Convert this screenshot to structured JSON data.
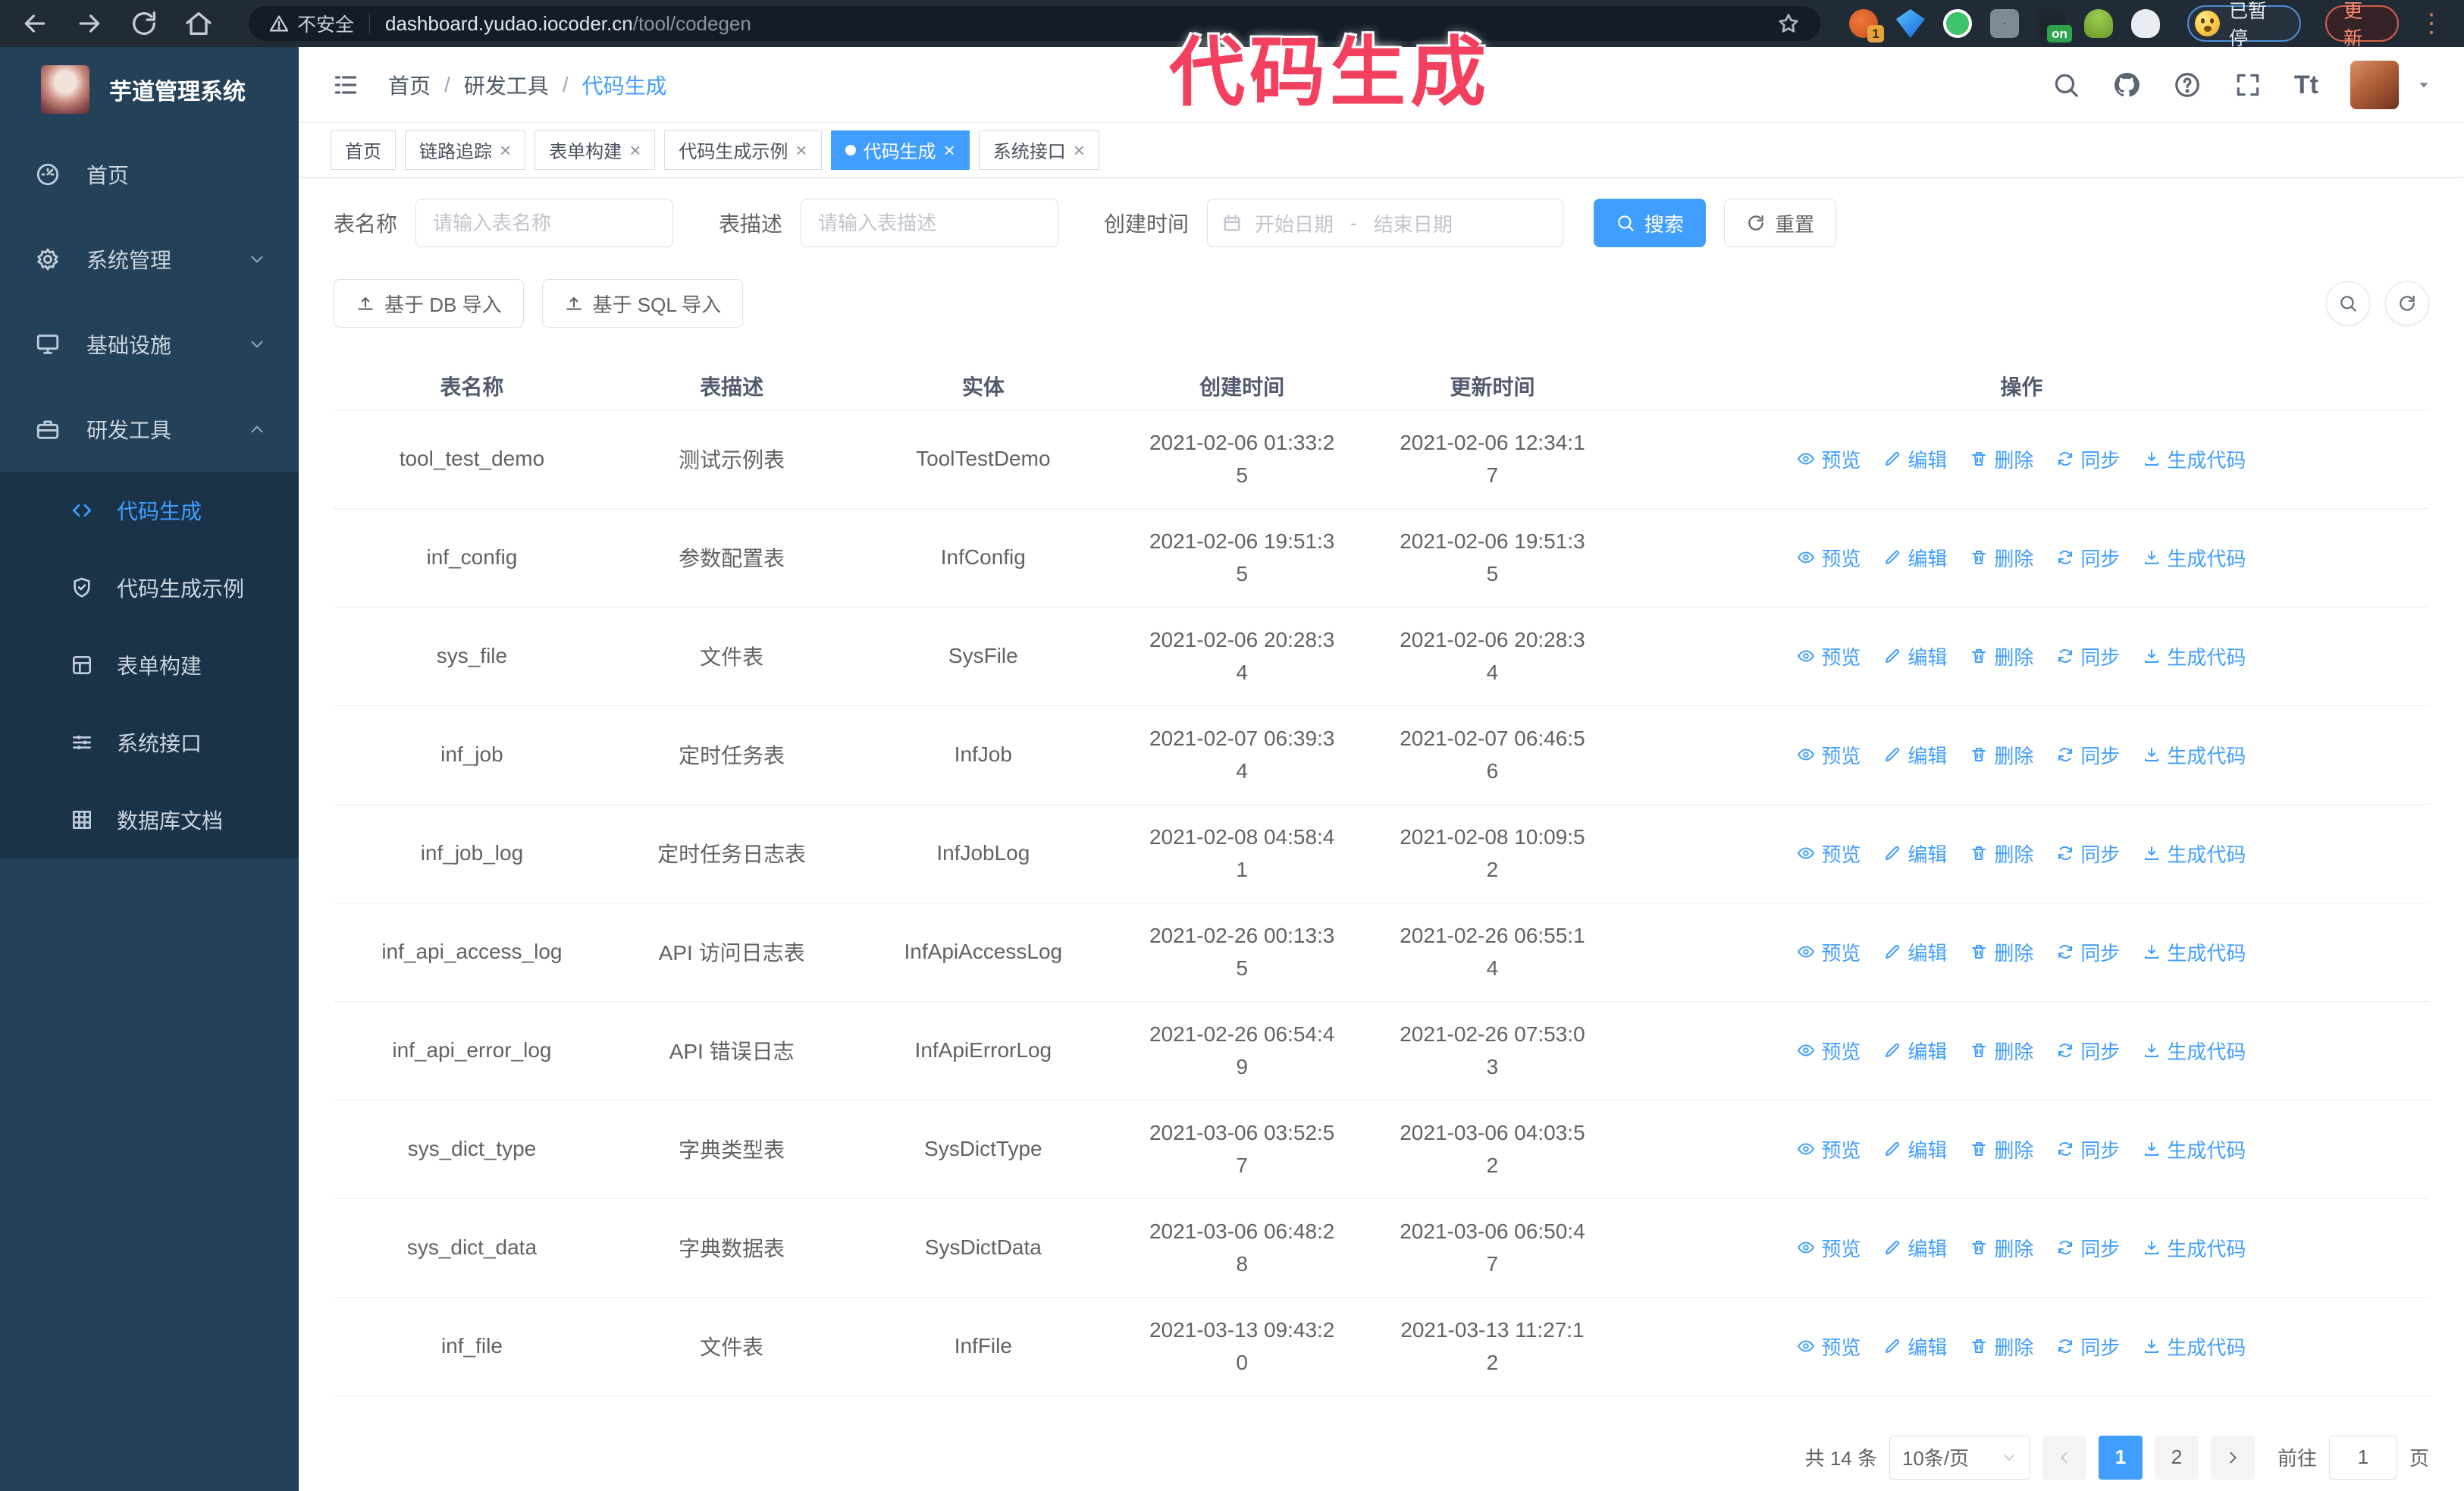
{
  "browser": {
    "security_label": "不安全",
    "url_host": "dashboard.yudao.iocoder.cn",
    "url_path": "/tool/codegen",
    "ext_badge_count": "1",
    "ext_badge_on": "on",
    "paused_label": "已暂停",
    "update_label": "更新"
  },
  "annotation": {
    "text": "代码生成"
  },
  "sidebar": {
    "title": "芋道管理系统",
    "items": [
      {
        "label": "首页"
      },
      {
        "label": "系统管理"
      },
      {
        "label": "基础设施"
      },
      {
        "label": "研发工具"
      }
    ],
    "sub_items": [
      {
        "label": "代码生成"
      },
      {
        "label": "代码生成示例"
      },
      {
        "label": "表单构建"
      },
      {
        "label": "系统接口"
      },
      {
        "label": "数据库文档"
      }
    ]
  },
  "breadcrumb": {
    "items": [
      "首页",
      "研发工具",
      "代码生成"
    ],
    "separator": "/"
  },
  "tabs": [
    {
      "label": "首页"
    },
    {
      "label": "链路追踪"
    },
    {
      "label": "表单构建"
    },
    {
      "label": "代码生成示例"
    },
    {
      "label": "代码生成"
    },
    {
      "label": "系统接口"
    }
  ],
  "filters": {
    "name_label": "表名称",
    "name_placeholder": "请输入表名称",
    "desc_label": "表描述",
    "desc_placeholder": "请输入表描述",
    "time_label": "创建时间",
    "start_placeholder": "开始日期",
    "range_separator": "-",
    "end_placeholder": "结束日期",
    "search_label": "搜索",
    "reset_label": "重置"
  },
  "toolbar": {
    "db_import_label": "基于 DB 导入",
    "sql_import_label": "基于 SQL 导入"
  },
  "table": {
    "columns": [
      "表名称",
      "表描述",
      "实体",
      "创建时间",
      "更新时间",
      "操作"
    ],
    "action_labels": [
      "预览",
      "编辑",
      "删除",
      "同步",
      "生成代码"
    ],
    "rows": [
      {
        "name": "tool_test_demo",
        "desc": "测试示例表",
        "entity": "ToolTestDemo",
        "created": "2021-02-06 01:33:25",
        "updated": "2021-02-06 12:34:17"
      },
      {
        "name": "inf_config",
        "desc": "参数配置表",
        "entity": "InfConfig",
        "created": "2021-02-06 19:51:35",
        "updated": "2021-02-06 19:51:35"
      },
      {
        "name": "sys_file",
        "desc": "文件表",
        "entity": "SysFile",
        "created": "2021-02-06 20:28:34",
        "updated": "2021-02-06 20:28:34"
      },
      {
        "name": "inf_job",
        "desc": "定时任务表",
        "entity": "InfJob",
        "created": "2021-02-07 06:39:34",
        "updated": "2021-02-07 06:46:56"
      },
      {
        "name": "inf_job_log",
        "desc": "定时任务日志表",
        "entity": "InfJobLog",
        "created": "2021-02-08 04:58:41",
        "updated": "2021-02-08 10:09:52"
      },
      {
        "name": "inf_api_access_log",
        "desc": "API 访问日志表",
        "entity": "InfApiAccessLog",
        "created": "2021-02-26 00:13:35",
        "updated": "2021-02-26 06:55:14"
      },
      {
        "name": "inf_api_error_log",
        "desc": "API 错误日志",
        "entity": "InfApiErrorLog",
        "created": "2021-02-26 06:54:49",
        "updated": "2021-02-26 07:53:03"
      },
      {
        "name": "sys_dict_type",
        "desc": "字典类型表",
        "entity": "SysDictType",
        "created": "2021-03-06 03:52:57",
        "updated": "2021-03-06 04:03:52"
      },
      {
        "name": "sys_dict_data",
        "desc": "字典数据表",
        "entity": "SysDictData",
        "created": "2021-03-06 06:48:28",
        "updated": "2021-03-06 06:50:47"
      },
      {
        "name": "inf_file",
        "desc": "文件表",
        "entity": "InfFile",
        "created": "2021-03-13 09:43:20",
        "updated": "2021-03-13 11:27:12"
      }
    ]
  },
  "pagination": {
    "total_label": "共 14 条",
    "page_size_label": "10条/页",
    "pages": [
      "1",
      "2"
    ],
    "goto_label": "前往",
    "goto_value": "1",
    "goto_suffix_label": "页"
  },
  "icons": {
    "close": "×",
    "kebab": "⋮",
    "font_size": "Tt"
  }
}
